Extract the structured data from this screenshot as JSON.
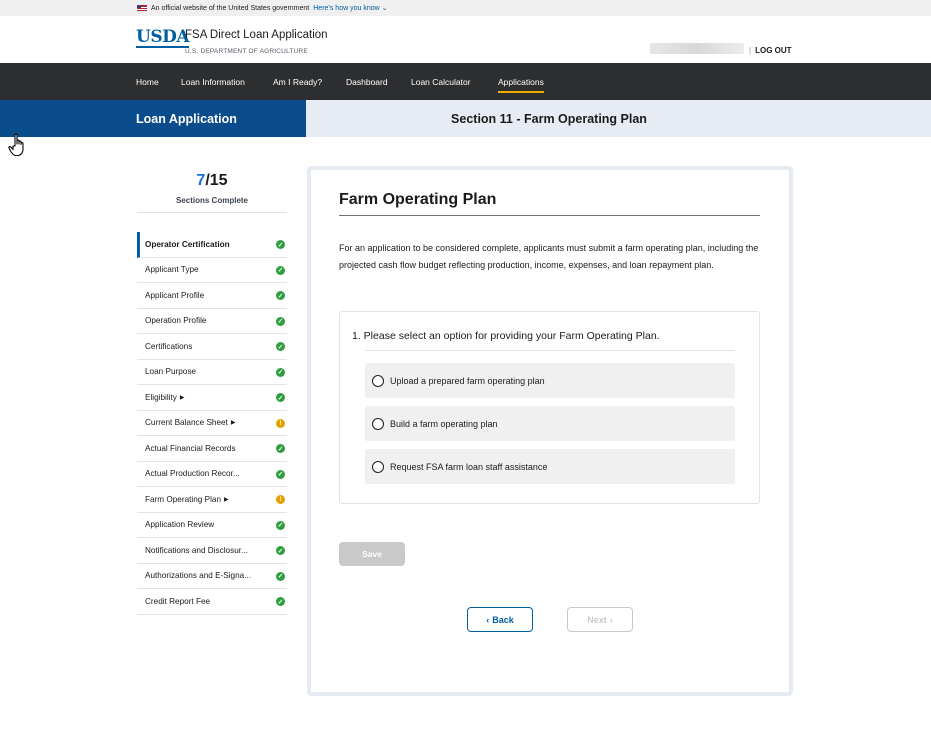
{
  "gov_banner": {
    "text": "An official website of the United States government",
    "link": "Here’s how you know ⌄"
  },
  "header": {
    "logo": "USDA",
    "title": "FSA Direct Loan Application",
    "subtitle": "U.S. DEPARTMENT OF AGRICULTURE",
    "logout": "LOG OUT"
  },
  "nav": {
    "items": [
      "Home",
      "Loan Information",
      "Am I Ready?",
      "Dashboard",
      "Loan Calculator",
      "Applications"
    ],
    "active": "Applications",
    "accent_color": "#f2a900"
  },
  "band": {
    "left_title": "Loan Application",
    "right_title": "Section 11 - Farm Operating Plan"
  },
  "progress": {
    "completed": "7",
    "total": "/15",
    "label": "Sections Complete"
  },
  "sidebar": {
    "items": [
      {
        "label": "Operator Certification",
        "status": "complete",
        "current": true
      },
      {
        "label": "Applicant Type",
        "status": "complete"
      },
      {
        "label": "Applicant Profile",
        "status": "complete"
      },
      {
        "label": "Operation Profile",
        "status": "complete"
      },
      {
        "label": "Certifications",
        "status": "complete"
      },
      {
        "label": "Loan Purpose",
        "status": "complete"
      },
      {
        "label": "Eligibility",
        "status": "complete",
        "expandable": true
      },
      {
        "label": "Current Balance Sheet",
        "status": "in-progress",
        "expandable": true
      },
      {
        "label": "Actual Financial Records",
        "status": "complete"
      },
      {
        "label": "Actual Production Recor...",
        "status": "complete"
      },
      {
        "label": "Farm Operating Plan",
        "status": "in-progress",
        "expandable": true
      },
      {
        "label": "Application Review",
        "status": "complete"
      },
      {
        "label": "Notifications and Disclosur...",
        "status": "complete"
      },
      {
        "label": "Authorizations and E-Signa...",
        "status": "complete"
      },
      {
        "label": "Credit Report Fee",
        "status": "complete"
      }
    ],
    "status_colors": {
      "complete": "#2e9e3f",
      "in-progress": "#e5a000"
    }
  },
  "main": {
    "title": "Farm Operating Plan",
    "intro": "For an application to be considered complete, applicants must submit a farm operating plan, including the projected cash flow budget reflecting production, income, expenses, and loan repayment plan.",
    "question": "1. Please select an option for providing your Farm Operating Plan.",
    "options": [
      "Upload a prepared farm operating plan",
      "Build a farm operating plan",
      "Request FSA farm loan staff assistance"
    ],
    "save_label": "Save",
    "back_label": "Back",
    "next_label": "Next"
  }
}
